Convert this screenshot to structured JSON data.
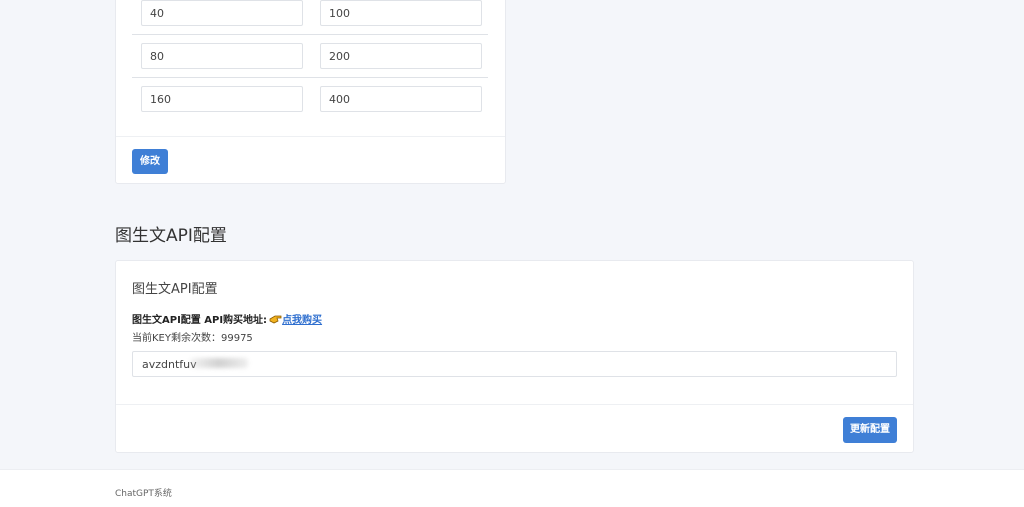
{
  "pricing": {
    "rows": [
      {
        "a": "40",
        "b": "100"
      },
      {
        "a": "80",
        "b": "200"
      },
      {
        "a": "160",
        "b": "400"
      }
    ],
    "modify_label": "修改"
  },
  "section_title": "图生文API配置",
  "api": {
    "card_title": "图生文API配置",
    "info_label": "图生文API配置 API购买地址:",
    "buy_link": "点我购买",
    "remaining": "当前KEY剩余次数：99975",
    "key_value": "avzdntfuv",
    "update_label": "更新配置"
  },
  "footer": {
    "text": "ChatGPT系统"
  },
  "icons": {
    "pointer": "pointing-hand-icon"
  },
  "colors": {
    "primary": "#3f7fd6",
    "link": "#2f6fcf",
    "background": "#f4f6fa"
  }
}
